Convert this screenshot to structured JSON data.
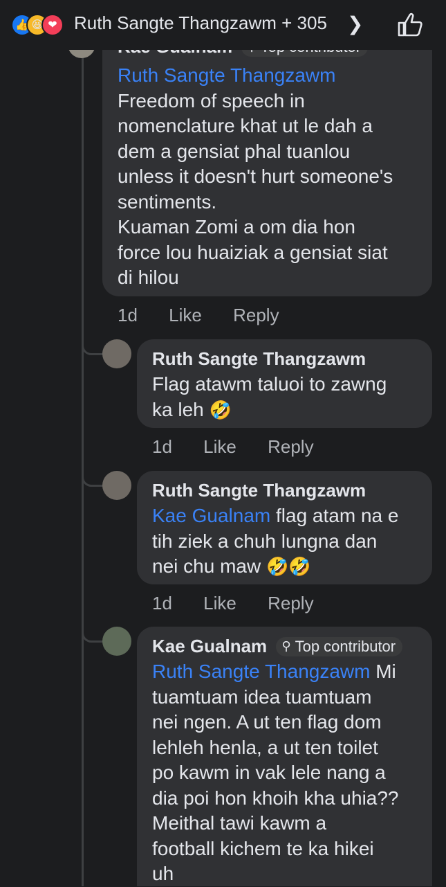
{
  "header": {
    "title": "Ruth Sangte Thangzawm + 305",
    "reaction_icons": [
      "like-icon",
      "haha-icon",
      "love-icon"
    ]
  },
  "comments": [
    {
      "author_partial": "Kae Gualnam",
      "badge_partial": "Top contributor",
      "mention": "Ruth Sangte Thangzawm",
      "lines": [
        "Freedom of speech in",
        "nomenclature khat ut le dah a",
        "dem a gensiat phal tuanlou",
        "unless it doesn't hurt someone's",
        "sentiments.",
        "Kuaman Zomi a om dia hon",
        "force lou huaiziak a gensiat siat",
        "di hilou"
      ],
      "time": "1d",
      "like": "Like",
      "reply": "Reply"
    },
    {
      "author": "Ruth Sangte Thangzawm",
      "line1": "Flag atawm taluoi to zawng",
      "line2": "ka leh",
      "emoji": "🤣",
      "time": "1d",
      "like": "Like",
      "reply": "Reply"
    },
    {
      "author": "Ruth Sangte Thangzawm",
      "mention": "Kae Gualnam",
      "line1_rest": " flag atam na e",
      "line2": "tih ziek a chuh lungna dan",
      "line3": "nei chu maw",
      "emoji": "🤣🤣",
      "time": "1d",
      "like": "Like",
      "reply": "Reply"
    },
    {
      "author": "Kae Gualnam",
      "badge": "Top contributor",
      "mention": "Ruth Sangte Thangzawm",
      "line1_rest": " Mi",
      "lines": [
        "tuamtuam idea tuamtuam",
        "nei ngen. A ut ten flag dom",
        "lehleh henla, a ut ten toilet",
        "po kawm in vak lele nang a",
        "dia poi hon khoih kha uhia??",
        "Meithal tawi kawm a",
        "football kichem te ka hikei",
        "uh"
      ]
    }
  ],
  "colors": {
    "background": "#1c1d1f",
    "bubble": "#303134",
    "mention": "#3a82f7",
    "meta": "#b0b3b8"
  }
}
